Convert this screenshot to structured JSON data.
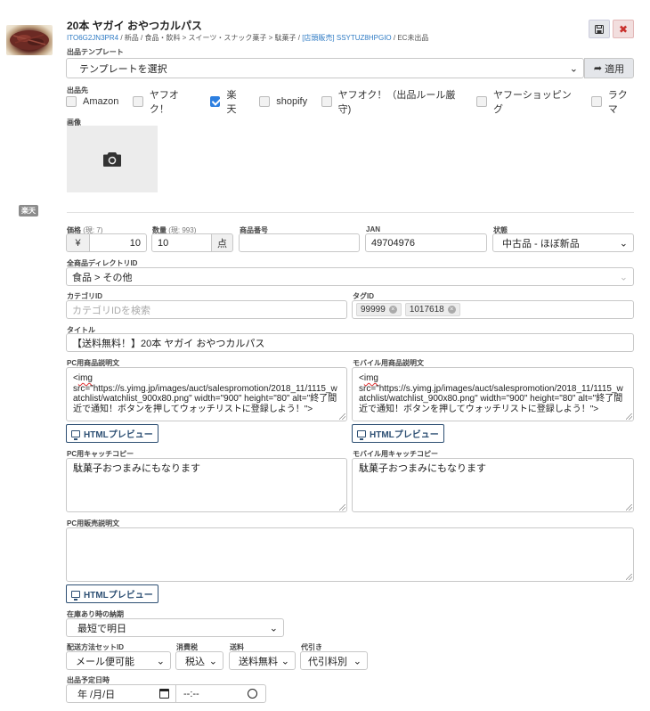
{
  "product": {
    "title": "20本 ヤガイ おやつカルパス",
    "item_id": "ITO6G2JN3PR4",
    "breadcrumb": " / 新品 / 食品・飲料 > スイーツ・スナック菓子 > 駄菓子 / ",
    "store_link": "[店頭販売] SSYTUZ8HPGIO",
    "ec_status": " / EC未出品"
  },
  "template": {
    "label": "出品テンプレート",
    "selected": "テンプレートを選択",
    "apply_label": "適用"
  },
  "destinations": {
    "label": "出品先",
    "items": [
      {
        "label": "Amazon",
        "checked": false
      },
      {
        "label": "ヤフオク！",
        "checked": false
      },
      {
        "label": "楽天",
        "checked": true
      },
      {
        "label": "shopify",
        "checked": false
      },
      {
        "label": "ヤフオク！（出品ルール厳守)",
        "checked": false
      },
      {
        "label": "ヤフーショッピング",
        "checked": false
      },
      {
        "label": "ラクマ",
        "checked": false
      }
    ]
  },
  "image_section": {
    "label": "画像"
  },
  "market_badge": "楽天",
  "fields": {
    "price": {
      "label": "価格",
      "hint": "(現: 7)",
      "currency": "¥",
      "value": "10"
    },
    "quantity": {
      "label": "数量",
      "hint": "(現: 993)",
      "value": "10",
      "unit": "点"
    },
    "product_number": {
      "label": "商品番号",
      "value": ""
    },
    "jan": {
      "label": "JAN",
      "value": "49704976"
    },
    "condition": {
      "label": "状態",
      "value": "中古品 - ほぼ新品"
    },
    "directory": {
      "label": "全商品ディレクトリID",
      "value": "食品 > その他"
    },
    "category": {
      "label": "カテゴリID",
      "placeholder": "カテゴリIDを検索"
    },
    "tags": {
      "label": "タグID",
      "items": [
        "99999",
        "1017618"
      ]
    },
    "title": {
      "label": "タイトル",
      "value": "【送料無料！】20本 ヤガイ おやつカルパス"
    },
    "pc_description": {
      "label": "PC用商品説明文",
      "line1": "img",
      "line2": "src=\"https://s.yimg.jp/images/auct/salespromotion/2018_11/1115_watchlist/watchlist_900x80.png\" width=\"900\" height=\"80\" alt=\"終了間近で通知！ボタンを押してウォッチリストに登録しよう！\">"
    },
    "mobile_description": {
      "label": "モバイル用商品説明文",
      "line1": "img",
      "line2": "src=\"https://s.yimg.jp/images/auct/salespromotion/2018_11/1115_watchlist/watchlist_900x80.png\" width=\"900\" height=\"80\" alt=\"終了間近で通知！ボタンを押してウォッチリストに登録しよう！\">"
    },
    "preview_label": "HTMLプレビュー",
    "pc_catch": {
      "label": "PC用キャッチコピー",
      "value": "駄菓子おつまみにもなります"
    },
    "mobile_catch": {
      "label": "モバイル用キャッチコピー",
      "value": "駄菓子おつまみにもなります"
    },
    "pc_sales_description": {
      "label": "PC用販売説明文",
      "value": ""
    },
    "delivery_in_stock": {
      "label": "在庫あり時の納期",
      "value": "最短で明日"
    },
    "shipping_set": {
      "label": "配送方法セットID",
      "value": "メール便可能"
    },
    "tax": {
      "label": "消費税",
      "value": "税込"
    },
    "shipping_fee": {
      "label": "送料",
      "value": "送料無料"
    },
    "cod": {
      "label": "代引き",
      "value": "代引料別"
    },
    "listing_date": {
      "label": "出品予定日時",
      "date_placeholder": "年 /月/日",
      "time_placeholder": "--:--"
    }
  },
  "colors": {
    "accent": "#2d7fe0",
    "link": "#2f7bc4",
    "delete": "#c9302c",
    "badge": "#8c8c8c",
    "preview_border": "#2d4f73"
  }
}
